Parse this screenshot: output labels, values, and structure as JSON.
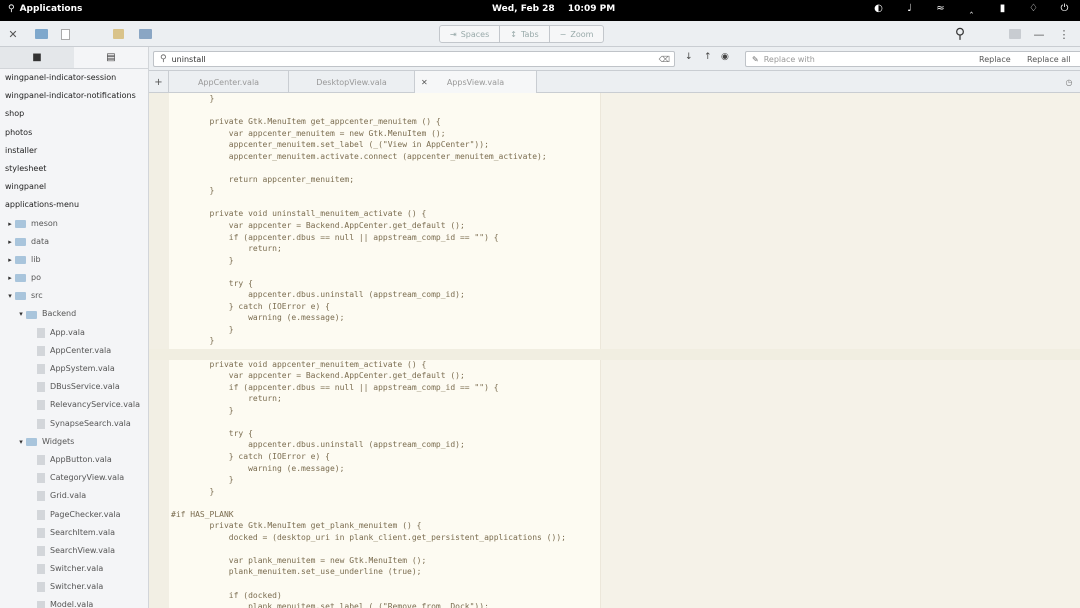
{
  "panel": {
    "applications_label": "Applications",
    "date": "Wed, Feb 28",
    "time": "10:09 PM",
    "tray_icons": [
      "night-light-icon",
      "volume-icon",
      "wifi-icon",
      "bluetooth-icon",
      "battery-icon",
      "notifications-icon",
      "power-icon"
    ]
  },
  "header": {
    "view_modes": [
      {
        "label": "Spaces",
        "icon": "spaces-icon"
      },
      {
        "label": "Tabs",
        "icon": "tabs-icon"
      },
      {
        "label": "Zoom",
        "icon": "zoom-icon"
      }
    ]
  },
  "search": {
    "query": "uninstall",
    "replace_placeholder": "Replace with",
    "replace_button": "Replace",
    "replace_all_button": "Replace all"
  },
  "tabs": [
    {
      "label": "AppCenter.vala",
      "active": true
    },
    {
      "label": "DesktopView.vala",
      "active": false
    },
    {
      "label": "AppsView.vala",
      "active": false
    }
  ],
  "sidebar": {
    "projects": [
      "wingpanel-indicator-session",
      "wingpanel-indicator-notifications",
      "shop",
      "photos",
      "installer",
      "stylesheet",
      "wingpanel",
      "applications-menu"
    ],
    "tree": [
      {
        "label": "meson",
        "type": "folder",
        "depth": 0,
        "expanded": false
      },
      {
        "label": "data",
        "type": "folder",
        "depth": 0,
        "expanded": false
      },
      {
        "label": "lib",
        "type": "folder",
        "depth": 0,
        "expanded": false
      },
      {
        "label": "po",
        "type": "folder",
        "depth": 0,
        "expanded": false
      },
      {
        "label": "src",
        "type": "folder",
        "depth": 0,
        "expanded": true
      },
      {
        "label": "Backend",
        "type": "folder",
        "depth": 1,
        "expanded": true
      },
      {
        "label": "App.vala",
        "type": "file",
        "depth": 2
      },
      {
        "label": "AppCenter.vala",
        "type": "file",
        "depth": 2
      },
      {
        "label": "AppSystem.vala",
        "type": "file",
        "depth": 2
      },
      {
        "label": "DBusService.vala",
        "type": "file",
        "depth": 2
      },
      {
        "label": "RelevancyService.vala",
        "type": "file",
        "depth": 2
      },
      {
        "label": "SynapseSearch.vala",
        "type": "file",
        "depth": 2
      },
      {
        "label": "Widgets",
        "type": "folder",
        "depth": 1,
        "expanded": true
      },
      {
        "label": "AppButton.vala",
        "type": "file",
        "depth": 2
      },
      {
        "label": "CategoryView.vala",
        "type": "file",
        "depth": 2
      },
      {
        "label": "Grid.vala",
        "type": "file",
        "depth": 2
      },
      {
        "label": "PageChecker.vala",
        "type": "file",
        "depth": 2
      },
      {
        "label": "SearchItem.vala",
        "type": "file",
        "depth": 2
      },
      {
        "label": "SearchView.vala",
        "type": "file",
        "depth": 2
      },
      {
        "label": "Switcher.vala",
        "type": "file",
        "depth": 2
      },
      {
        "label": "Switcher.vala",
        "type": "file",
        "depth": 2
      },
      {
        "label": "Model.vala",
        "type": "file",
        "depth": 2
      }
    ]
  },
  "code": {
    "lines": [
      {
        "n": "",
        "t": "        }"
      },
      {
        "n": "",
        "t": ""
      },
      {
        "n": "",
        "t": "        private Gtk.MenuItem get_appcenter_menuitem () {"
      },
      {
        "n": "",
        "t": "            var appcenter_menuitem = new Gtk.MenuItem ();"
      },
      {
        "n": "",
        "t": "            appcenter_menuitem.set_label (_(\"View in AppCenter\"));"
      },
      {
        "n": "",
        "t": "            appcenter_menuitem.activate.connect (appcenter_menuitem_activate);"
      },
      {
        "n": "",
        "t": ""
      },
      {
        "n": "",
        "t": "            return appcenter_menuitem;"
      },
      {
        "n": "",
        "t": "        }"
      },
      {
        "n": "",
        "t": ""
      },
      {
        "n": "",
        "t": "        private void uninstall_menuitem_activate () {"
      },
      {
        "n": "",
        "t": "            var appcenter = Backend.AppCenter.get_default ();"
      },
      {
        "n": "",
        "t": "            if (appcenter.dbus == null || appstream_comp_id == \"\") {"
      },
      {
        "n": "",
        "t": "                return;"
      },
      {
        "n": "",
        "t": "            }"
      },
      {
        "n": "",
        "t": ""
      },
      {
        "n": "",
        "t": "            try {"
      },
      {
        "n": "",
        "t": "                appcenter.dbus.uninstall (appstream_comp_id);"
      },
      {
        "n": "",
        "t": "            } catch (IOError e) {"
      },
      {
        "n": "",
        "t": "                warning (e.message);"
      },
      {
        "n": "",
        "t": "            }"
      },
      {
        "n": "",
        "t": "        }"
      },
      {
        "n": "",
        "t": ""
      },
      {
        "n": "",
        "t": "        private void appcenter_menuitem_activate () {"
      },
      {
        "n": "",
        "t": "            var appcenter = Backend.AppCenter.get_default ();"
      },
      {
        "n": "",
        "t": "            if (appcenter.dbus == null || appstream_comp_id == \"\") {"
      },
      {
        "n": "",
        "t": "                return;"
      },
      {
        "n": "",
        "t": "            }"
      },
      {
        "n": "",
        "t": ""
      },
      {
        "n": "",
        "t": "            try {"
      },
      {
        "n": "",
        "t": "                appcenter.dbus.uninstall (appstream_comp_id);"
      },
      {
        "n": "",
        "t": "            } catch (IOError e) {"
      },
      {
        "n": "",
        "t": "                warning (e.message);"
      },
      {
        "n": "",
        "t": "            }"
      },
      {
        "n": "",
        "t": "        }"
      },
      {
        "n": "",
        "t": ""
      },
      {
        "n": "",
        "t": "#if HAS_PLANK"
      },
      {
        "n": "",
        "t": "        private Gtk.MenuItem get_plank_menuitem () {"
      },
      {
        "n": "",
        "t": "            docked = (desktop_uri in plank_client.get_persistent_applications ());"
      },
      {
        "n": "",
        "t": ""
      },
      {
        "n": "",
        "t": "            var plank_menuitem = new Gtk.MenuItem ();"
      },
      {
        "n": "",
        "t": "            plank_menuitem.set_use_underline (true);"
      },
      {
        "n": "",
        "t": ""
      },
      {
        "n": "",
        "t": "            if (docked)"
      },
      {
        "n": "",
        "t": "                plank_menuitem.set_label (_(\"Remove from _Dock\"));"
      },
      {
        "n": "",
        "t": "            }"
      }
    ]
  }
}
